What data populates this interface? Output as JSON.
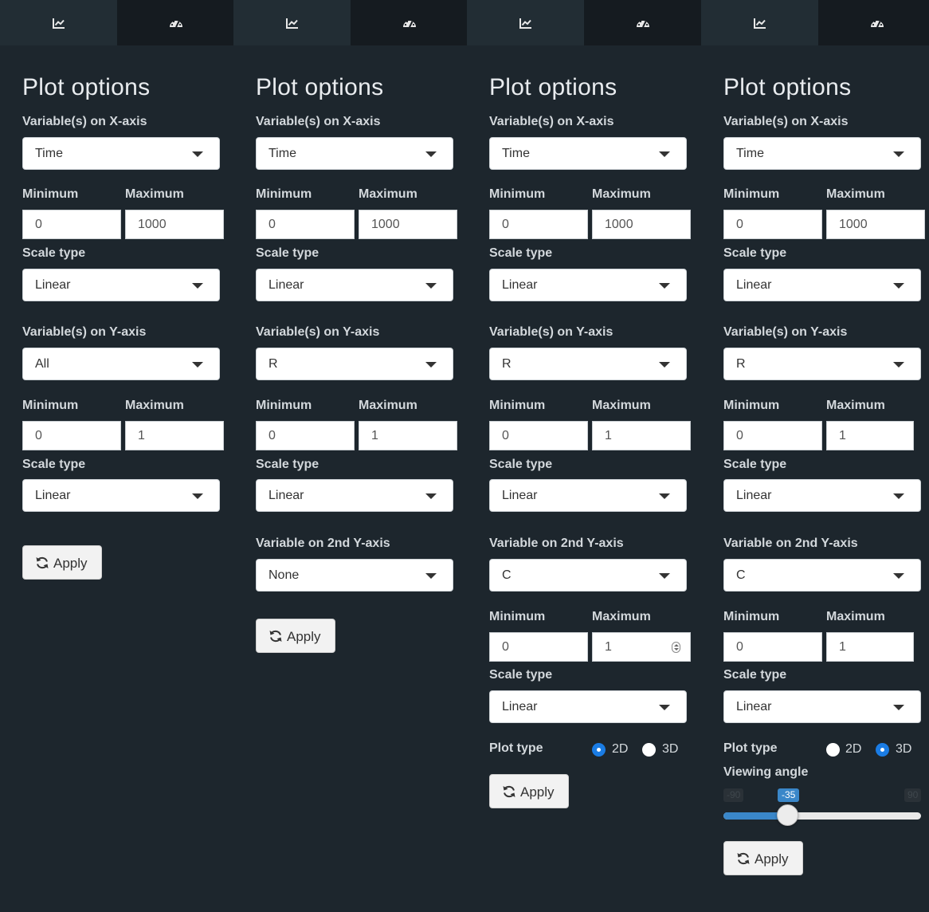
{
  "icons": {
    "plot_tab": "line-chart-icon",
    "dashboard_tab": "dashboard-icon",
    "apply": "refresh-icon"
  },
  "colors": {
    "panel_bg": "#1d262d",
    "active_tab": "#222d34",
    "inactive_tab": "#151b20",
    "radio_selected": "#1a7ce4",
    "slider_fill": "#3a87c9"
  },
  "panels": [
    {
      "title": "Plot options",
      "x_axis": {
        "label": "Variable(s) on X-axis",
        "value": "Time",
        "min_label": "Minimum",
        "max_label": "Maximum",
        "min": "0",
        "max": "1000",
        "scale_label": "Scale type",
        "scale": "Linear"
      },
      "y_axis": {
        "label": "Variable(s) on Y-axis",
        "value": "All",
        "min_label": "Minimum",
        "max_label": "Maximum",
        "min": "0",
        "max": "1",
        "scale_label": "Scale type",
        "scale": "Linear"
      },
      "apply": "Apply"
    },
    {
      "title": "Plot options",
      "x_axis": {
        "label": "Variable(s) on X-axis",
        "value": "Time",
        "min_label": "Minimum",
        "max_label": "Maximum",
        "min": "0",
        "max": "1000",
        "scale_label": "Scale type",
        "scale": "Linear"
      },
      "y_axis": {
        "label": "Variable(s) on Y-axis",
        "value": "R",
        "min_label": "Minimum",
        "max_label": "Maximum",
        "min": "0",
        "max": "1",
        "scale_label": "Scale type",
        "scale": "Linear"
      },
      "y2_axis": {
        "label": "Variable on 2nd Y-axis",
        "value": "None"
      },
      "apply": "Apply"
    },
    {
      "title": "Plot options",
      "x_axis": {
        "label": "Variable(s) on X-axis",
        "value": "Time",
        "min_label": "Minimum",
        "max_label": "Maximum",
        "min": "0",
        "max": "1000",
        "scale_label": "Scale type",
        "scale": "Linear"
      },
      "y_axis": {
        "label": "Variable(s) on Y-axis",
        "value": "R",
        "min_label": "Minimum",
        "max_label": "Maximum",
        "min": "0",
        "max": "1",
        "scale_label": "Scale type",
        "scale": "Linear"
      },
      "y2_axis": {
        "label": "Variable on 2nd Y-axis",
        "value": "C",
        "min_label": "Minimum",
        "max_label": "Maximum",
        "min": "0",
        "max": "1",
        "scale_label": "Scale type",
        "scale": "Linear"
      },
      "plot_type": {
        "label": "Plot type",
        "options": [
          "2D",
          "3D"
        ],
        "selected": "2D"
      },
      "apply": "Apply"
    },
    {
      "title": "Plot options",
      "x_axis": {
        "label": "Variable(s) on X-axis",
        "value": "Time",
        "min_label": "Minimum",
        "max_label": "Maximum",
        "min": "0",
        "max": "1000",
        "scale_label": "Scale type",
        "scale": "Linear"
      },
      "y_axis": {
        "label": "Variable(s) on Y-axis",
        "value": "R",
        "min_label": "Minimum",
        "max_label": "Maximum",
        "min": "0",
        "max": "1",
        "scale_label": "Scale type",
        "scale": "Linear"
      },
      "y2_axis": {
        "label": "Variable on 2nd Y-axis",
        "value": "C",
        "min_label": "Minimum",
        "max_label": "Maximum",
        "min": "0",
        "max": "1",
        "scale_label": "Scale type",
        "scale": "Linear"
      },
      "plot_type": {
        "label": "Plot type",
        "options": [
          "2D",
          "3D"
        ],
        "selected": "3D"
      },
      "viewing_angle": {
        "label": "Viewing angle",
        "min": "-90",
        "max": "90",
        "value": "-35"
      },
      "apply": "Apply"
    }
  ]
}
